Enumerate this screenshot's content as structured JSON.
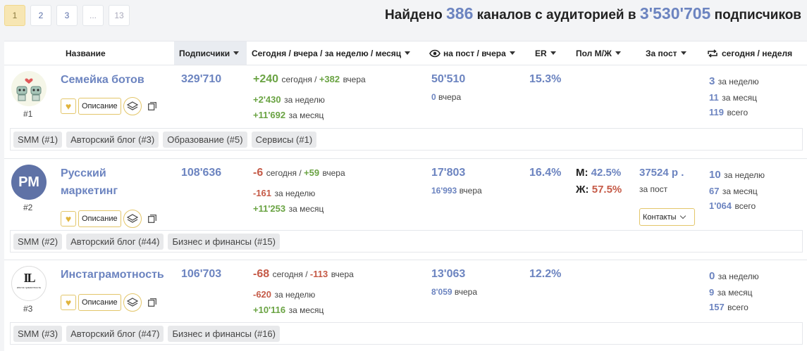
{
  "pagination": {
    "pages": [
      "1",
      "2",
      "3",
      "...",
      "13"
    ],
    "active": "1"
  },
  "summary": {
    "prefix": "Найдено",
    "count": "386",
    "middle": "каналов с аудиторией в",
    "audience": "3'530'705",
    "suffix": "подписчиков"
  },
  "header": {
    "name": "Название",
    "subscribers": "Подписчики",
    "growth": "Сегодня / вчера / за неделю / месяц",
    "views": "на пост / вчера",
    "er": "ER",
    "gender": "Пол М/Ж",
    "price": "За пост",
    "reposts": "сегодня / неделя"
  },
  "labels": {
    "today": "сегодня",
    "yesterday": "вчера",
    "week": "за неделю",
    "month": "за месяц",
    "total": "всего",
    "per_post": "за пост",
    "description": "Описание",
    "contacts": "Контакты",
    "male": "М:",
    "female": "Ж:"
  },
  "rows": [
    {
      "rank": "#1",
      "name": "Семейка ботов",
      "subscribers": "329'710",
      "today": "+240",
      "yesterday": "+382",
      "week": "+2'430",
      "month": "+11'692",
      "views": "50'510",
      "views_yesterday": "0",
      "er": "15.3%",
      "rep_week": "3",
      "rep_month": "11",
      "rep_total": "119",
      "tags": [
        "SMM (#1)",
        "Авторский блог (#3)",
        "Образование (#5)",
        "Сервисы (#1)"
      ]
    },
    {
      "rank": "#2",
      "name": "Русский маркетинг",
      "avatar_text": "РМ",
      "subscribers": "108'636",
      "today": "-6",
      "yesterday": "+59",
      "week": "-161",
      "month": "+11'253",
      "views": "17'803",
      "views_yesterday": "16'993",
      "er": "16.4%",
      "male": "42.5%",
      "female": "57.5%",
      "price": "37524 р .",
      "rep_week": "10",
      "rep_month": "67",
      "rep_total": "1'064",
      "tags": [
        "SMM (#2)",
        "Авторский блог (#44)",
        "Бизнес и финансы (#15)"
      ]
    },
    {
      "rank": "#3",
      "name": "Инстаграмотность",
      "avatar_text": "IL",
      "avatar_sub": "инста грамотность",
      "subscribers": "106'703",
      "today": "-68",
      "yesterday": "-113",
      "week": "-620",
      "month": "+10'116",
      "views": "13'063",
      "views_yesterday": "8'059",
      "er": "12.2%",
      "rep_week": "0",
      "rep_month": "9",
      "rep_total": "157",
      "tags": [
        "SMM (#3)",
        "Авторский блог (#47)",
        "Бизнес и финансы (#16)"
      ]
    }
  ],
  "colors": {
    "accent_blue": "#6c84c0",
    "positive": "#6aa343",
    "negative": "#c55a47",
    "gold": "#e3c66a"
  }
}
